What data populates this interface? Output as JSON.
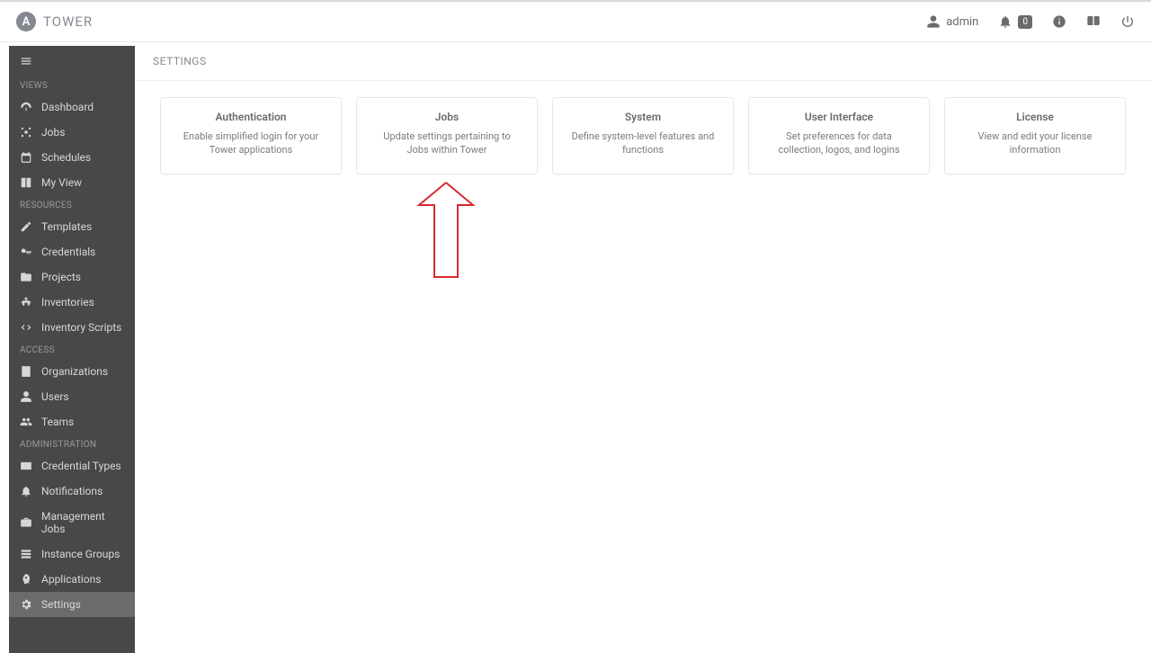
{
  "brand": {
    "name": "TOWER",
    "logo_letter": "A"
  },
  "topbar": {
    "user_label": "admin",
    "notification_count": "0"
  },
  "page": {
    "title": "SETTINGS"
  },
  "sidebar": {
    "sections": [
      {
        "label": "VIEWS",
        "items": [
          {
            "key": "dashboard",
            "label": "Dashboard"
          },
          {
            "key": "jobs",
            "label": "Jobs"
          },
          {
            "key": "schedules",
            "label": "Schedules"
          },
          {
            "key": "myview",
            "label": "My View"
          }
        ]
      },
      {
        "label": "RESOURCES",
        "items": [
          {
            "key": "templates",
            "label": "Templates"
          },
          {
            "key": "credentials",
            "label": "Credentials"
          },
          {
            "key": "projects",
            "label": "Projects"
          },
          {
            "key": "inventories",
            "label": "Inventories"
          },
          {
            "key": "inventory-scripts",
            "label": "Inventory Scripts"
          }
        ]
      },
      {
        "label": "ACCESS",
        "items": [
          {
            "key": "organizations",
            "label": "Organizations"
          },
          {
            "key": "users",
            "label": "Users"
          },
          {
            "key": "teams",
            "label": "Teams"
          }
        ]
      },
      {
        "label": "ADMINISTRATION",
        "items": [
          {
            "key": "credential-types",
            "label": "Credential Types"
          },
          {
            "key": "notifications",
            "label": "Notifications"
          },
          {
            "key": "management-jobs",
            "label": "Management Jobs"
          },
          {
            "key": "instance-groups",
            "label": "Instance Groups"
          },
          {
            "key": "applications",
            "label": "Applications"
          },
          {
            "key": "settings",
            "label": "Settings"
          }
        ]
      }
    ]
  },
  "cards": [
    {
      "key": "authentication",
      "title": "Authentication",
      "desc": "Enable simplified login for your Tower applications"
    },
    {
      "key": "jobs",
      "title": "Jobs",
      "desc": "Update settings pertaining to Jobs within Tower"
    },
    {
      "key": "system",
      "title": "System",
      "desc": "Define system-level features and functions"
    },
    {
      "key": "user-interface",
      "title": "User Interface",
      "desc": "Set preferences for data collection, logos, and logins"
    },
    {
      "key": "license",
      "title": "License",
      "desc": "View and edit your license information"
    }
  ],
  "annotation": {
    "arrow_color": "#d9282f"
  }
}
